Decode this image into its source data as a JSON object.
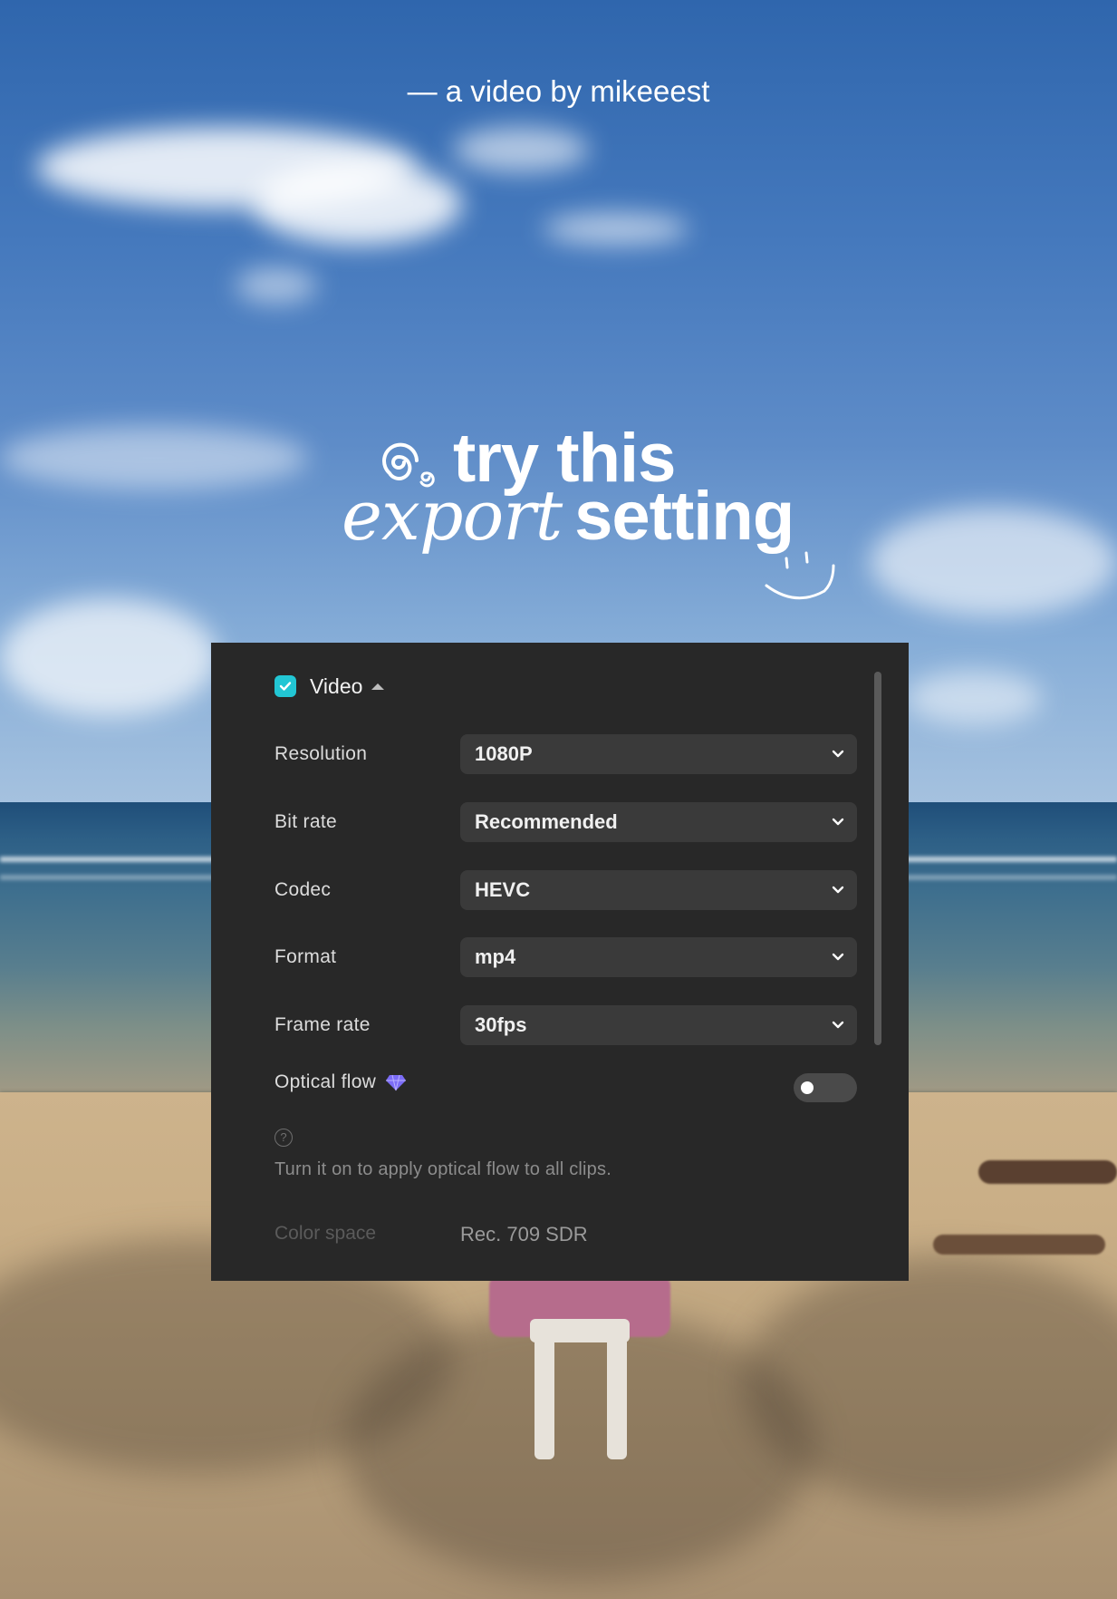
{
  "overlay": {
    "byline": "— a video by mikeeest",
    "headline_line1": "try this",
    "headline_line2_italic": "export",
    "headline_line2_rest": "setting"
  },
  "panel": {
    "section_title": "Video",
    "section_checked": true,
    "settings": [
      {
        "label": "Resolution",
        "value": "1080P"
      },
      {
        "label": "Bit rate",
        "value": "Recommended"
      },
      {
        "label": "Codec",
        "value": "HEVC"
      },
      {
        "label": "Format",
        "value": "mp4"
      },
      {
        "label": "Frame rate",
        "value": "30fps"
      }
    ],
    "optical_flow": {
      "label": "Optical flow",
      "enabled": false,
      "hint": "Turn it on to apply optical flow to all clips."
    },
    "color_space": {
      "label": "Color space",
      "value": "Rec. 709 SDR"
    }
  },
  "colors": {
    "accent": "#22c6d4",
    "panel_bg": "#282828",
    "select_bg": "#3a3a3a",
    "premium_gem": "#7b6cf6"
  },
  "icons": {
    "checkbox": "checkmark-icon",
    "section_toggle": "caret-up-icon",
    "dropdown": "chevron-down-icon",
    "premium": "gem-icon",
    "help": "help-circle-icon",
    "decor_top": "swirl-icon",
    "decor_bottom": "smile-icon"
  }
}
